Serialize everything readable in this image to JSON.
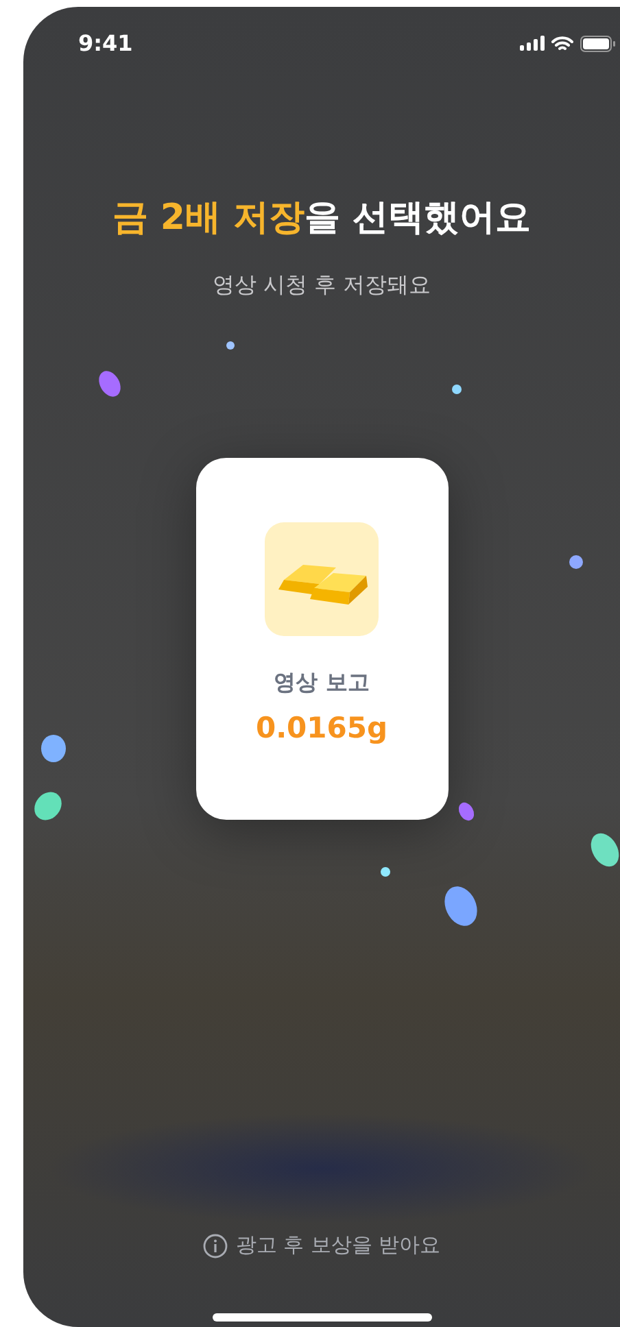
{
  "status_bar": {
    "time": "9:41"
  },
  "title": "**금 2배 저장**을 선택했어요",
  "subtitle": "영상 시청 후 저장돼요",
  "reward_card": {
    "label": "영상 보고",
    "amount": "0.0165g"
  },
  "footer_note": "광고 후 보상을 받아요"
}
